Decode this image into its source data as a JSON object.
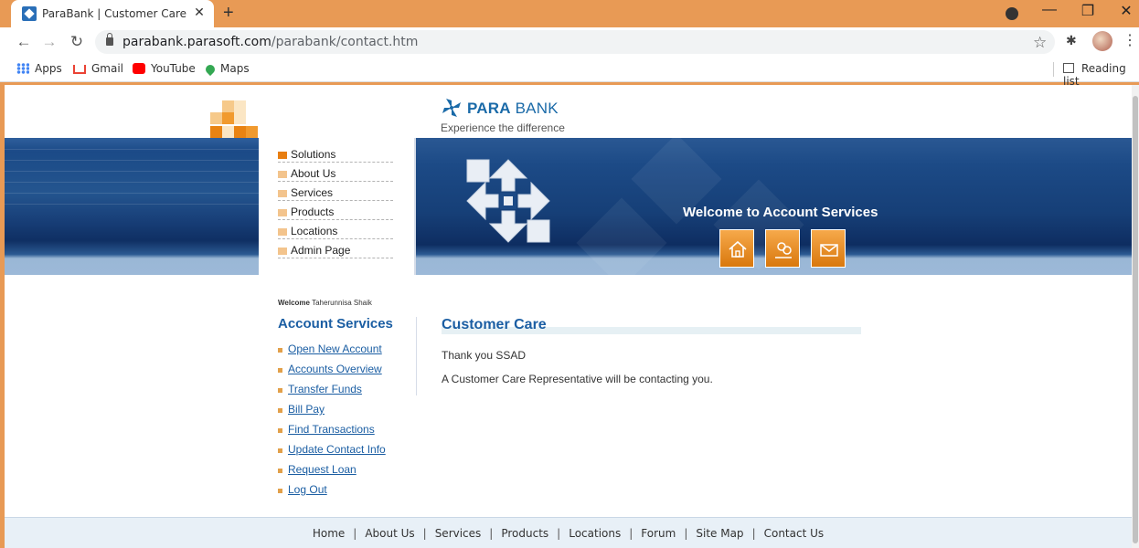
{
  "browser": {
    "tab_title": "ParaBank | Customer Care",
    "tab_close": "✕",
    "new_tab": "+",
    "url_host": "parabank.parasoft.com",
    "url_path": "/parabank/contact.htm",
    "window_controls": {
      "minimize": "—",
      "maximize": "❐",
      "close": "✕"
    },
    "bookmarks": [
      {
        "label": "Apps",
        "icon": "apps-grid-icon"
      },
      {
        "label": "Gmail",
        "icon": "gmail-icon"
      },
      {
        "label": "YouTube",
        "icon": "youtube-icon"
      },
      {
        "label": "Maps",
        "icon": "maps-icon"
      }
    ],
    "reading_list": "Reading list",
    "colors": {
      "frame": "#e89a55"
    }
  },
  "site": {
    "brand_bold": "PARA",
    "brand_thin": " BANK",
    "tagline": "Experience the difference",
    "colors": {
      "brand_blue": "#1a6aa8",
      "accent_orange": "#e87e11",
      "banner_navy": "#163f77"
    }
  },
  "topnav": {
    "items": [
      {
        "label": "Solutions",
        "active": true
      },
      {
        "label": "About Us",
        "active": false
      },
      {
        "label": "Services",
        "active": false
      },
      {
        "label": "Products",
        "active": false
      },
      {
        "label": "Locations",
        "active": false
      },
      {
        "label": "Admin Page",
        "active": false
      }
    ]
  },
  "banner": {
    "welcome": "Welcome to Account Services",
    "buttons": [
      {
        "name": "home",
        "icon": "home-icon"
      },
      {
        "name": "about",
        "icon": "about-icon"
      },
      {
        "name": "contact",
        "icon": "mail-icon"
      }
    ]
  },
  "user": {
    "welcome_label": "Welcome",
    "name": "Taherunnisa Shaik"
  },
  "sidebar": {
    "title": "Account Services",
    "links": [
      "Open New Account",
      "Accounts Overview",
      "Transfer Funds",
      "Bill Pay",
      "Find Transactions",
      "Update Contact Info",
      "Request Loan",
      "Log Out"
    ]
  },
  "content": {
    "title": "Customer Care",
    "lines": [
      "Thank you SSAD",
      "A Customer Care Representative will be contacting you."
    ]
  },
  "footer": {
    "links": [
      "Home",
      "About Us",
      "Services",
      "Products",
      "Locations",
      "Forum",
      "Site Map",
      "Contact Us"
    ],
    "separator": "|"
  }
}
